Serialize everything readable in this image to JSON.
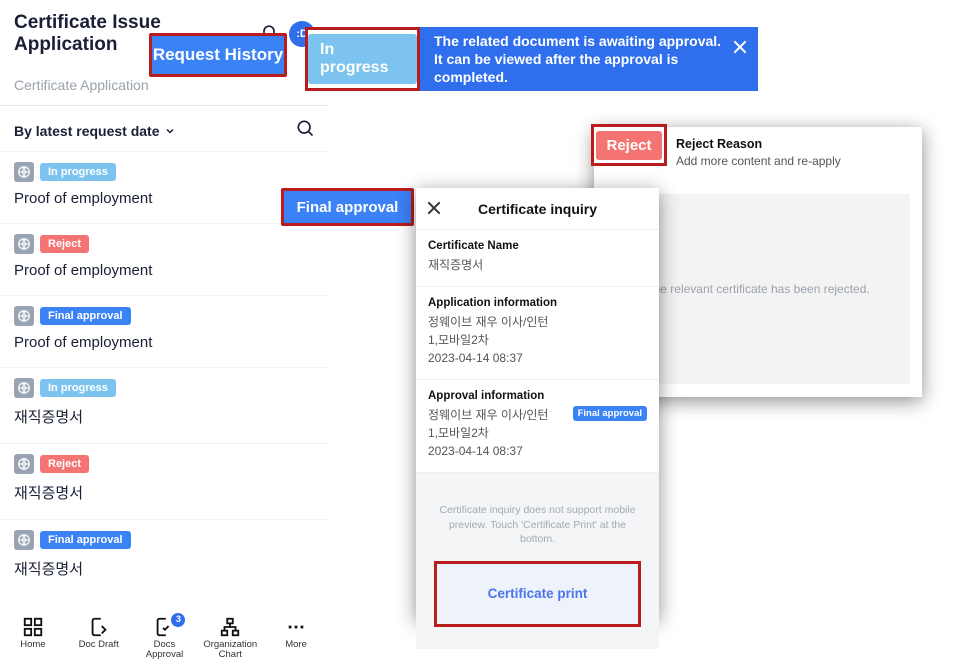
{
  "page_title": "Certificate Issue Application",
  "avatar_initials": ":D",
  "tabs": {
    "application": "Certificate Application"
  },
  "callouts": {
    "request_history": "Request History",
    "in_progress": "In progress",
    "final_approval": "Final approval",
    "reject": "Reject"
  },
  "sort": {
    "label": "By latest request date"
  },
  "status_labels": {
    "in_progress": "In progress",
    "reject": "Reject",
    "final_approval": "Final approval"
  },
  "items": [
    {
      "status": "in_progress",
      "title": "Proof of employment"
    },
    {
      "status": "reject",
      "title": "Proof of employment"
    },
    {
      "status": "final_approval",
      "title": "Proof of employment"
    },
    {
      "status": "in_progress",
      "title": "재직증명서"
    },
    {
      "status": "reject",
      "title": "재직증명서"
    },
    {
      "status": "final_approval",
      "title": "재직증명서"
    }
  ],
  "toast": {
    "message": "The related document is awaiting approval. It can be viewed after the approval is completed."
  },
  "reject_panel": {
    "label": "Reject Reason",
    "text": "Add more content and re-apply",
    "placeholder": "The relevant certificate has been rejected."
  },
  "inquiry": {
    "title": "Certificate inquiry",
    "cert_name_label": "Certificate Name",
    "cert_name_value": "재직증명서",
    "app_label": "Application information",
    "app_line1": "정웨이브 재우 이사/인턴",
    "app_line2": "1,모바일2차",
    "app_line3": "2023-04-14 08:37",
    "approval_label": "Approval information",
    "approval_line1": "정웨이브 재우 이사/인턴",
    "approval_line2": "1,모바일2차",
    "approval_line3": "2023-04-14 08:37",
    "approval_chip": "Final approval",
    "preview_hint": "Certificate inquiry does not support mobile preview. Touch 'Certificate Print' at the bottom.",
    "print_button": "Certificate print"
  },
  "bottom_nav": {
    "home": "Home",
    "draft": "Doc Draft",
    "approval": "Docs Approval",
    "approval_badge": "3",
    "org": "Organization Chart",
    "more": "More"
  }
}
